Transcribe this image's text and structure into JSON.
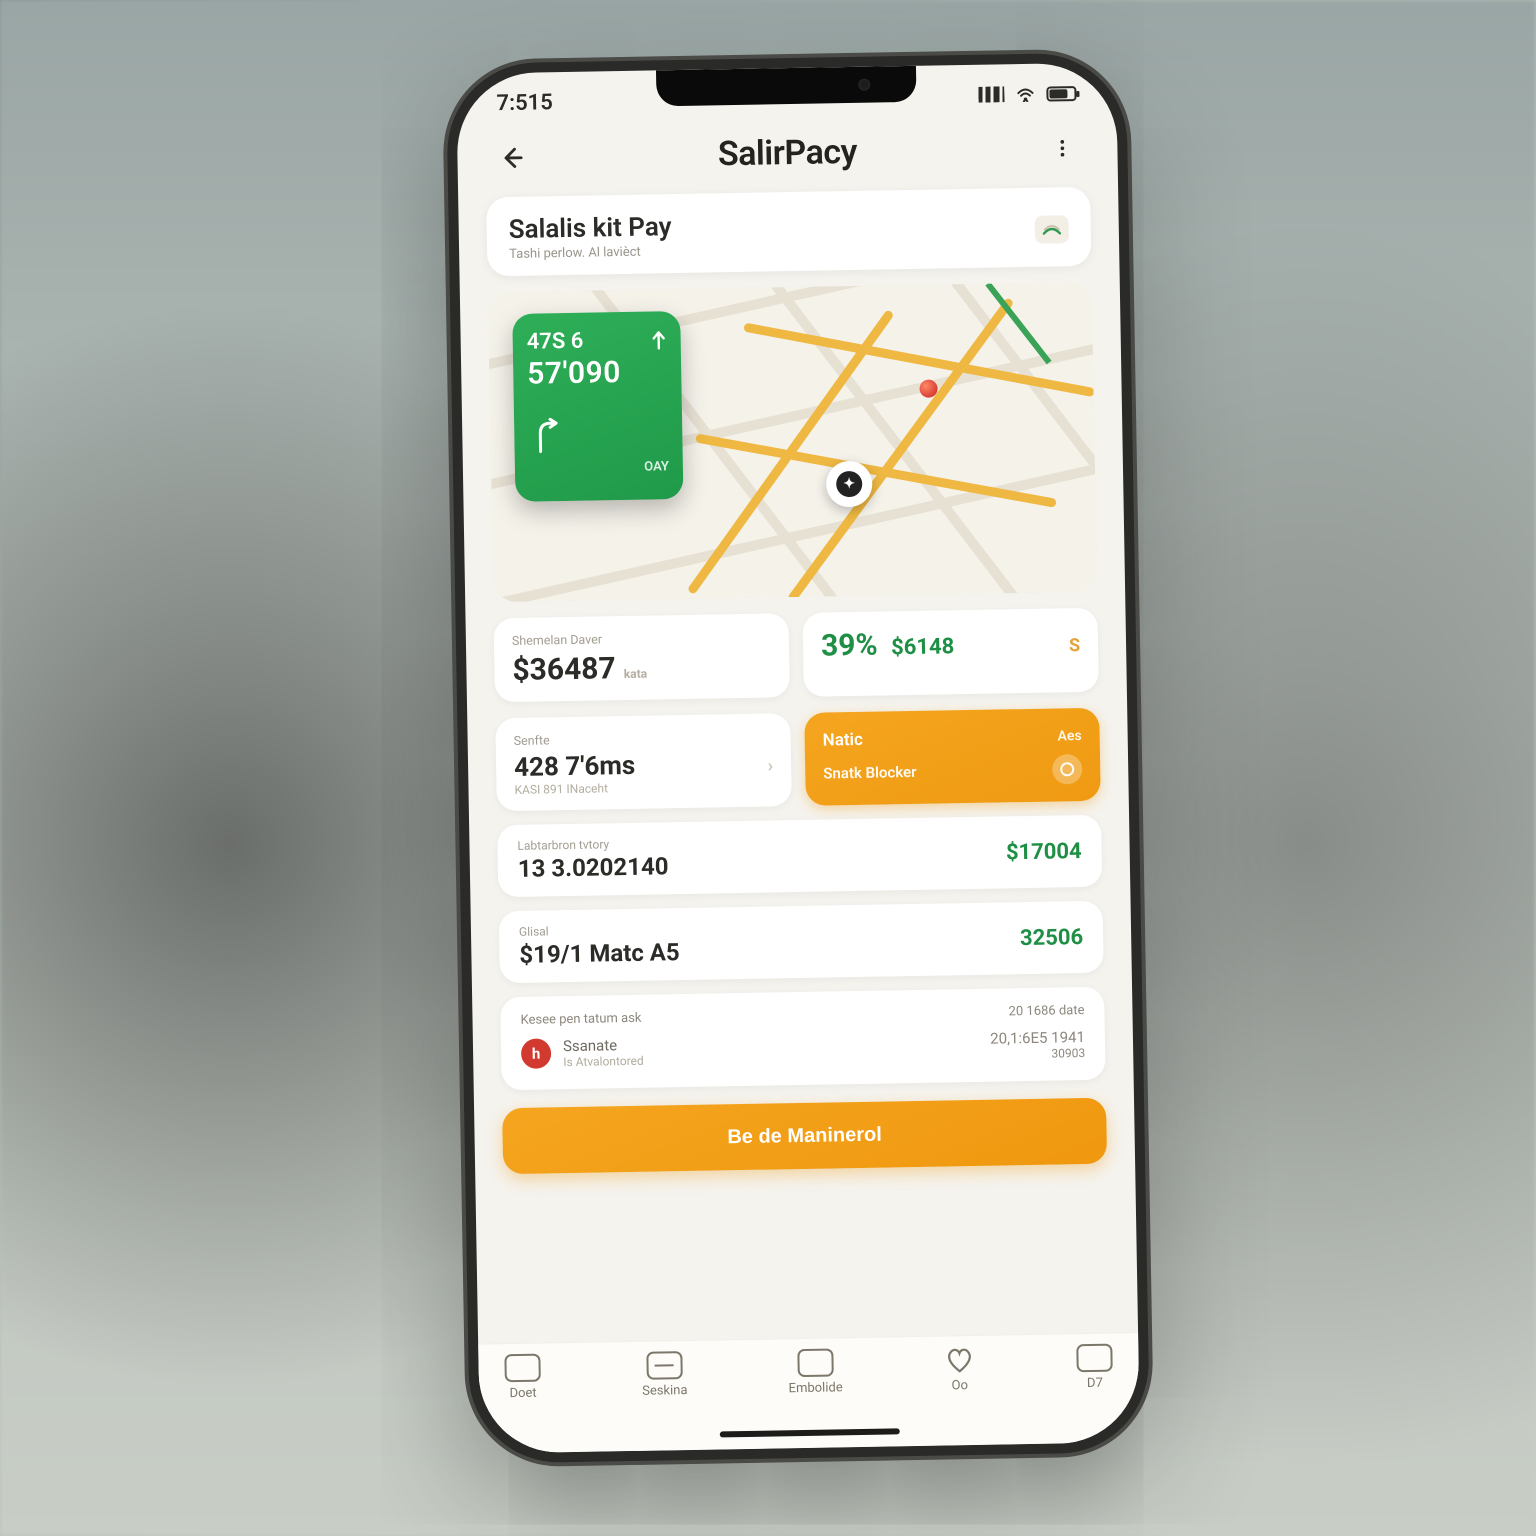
{
  "status": {
    "time": "7:515"
  },
  "appbar": {
    "title": "SalirPacy"
  },
  "search": {
    "title": "Salalis kit Pay",
    "subtitle": "Tashi perlow. Al lavièct"
  },
  "mapcard": {
    "line1": "47S 6",
    "line2": "57'090",
    "corner": "OAY"
  },
  "tiles": {
    "balance": {
      "label": "Shemelan Daver",
      "value": "$36487",
      "suffix": "kata"
    },
    "earnings": {
      "pct": "39%",
      "amt": "$6148",
      "suffix": "S"
    },
    "trips": {
      "label": "Senfte",
      "value": "428 7'6ms",
      "sub": "KASI 891 INaceht"
    },
    "action": {
      "line1_left": "Natic",
      "line1_right": "Aes",
      "line2": "Snatk Blocker"
    }
  },
  "rows": {
    "r1": {
      "label": "Labtarbron tvtory",
      "value": "13 3.0202140",
      "right": "$17004"
    },
    "r2": {
      "label": "Glisal",
      "value": "$19/1 Matc A5",
      "right": "32506"
    }
  },
  "summary": {
    "header_left": "Kesee pen tatum ask",
    "header_right": "20 1686 date",
    "line1": "Ssanate",
    "line1_amt": "20,1:6E5 1941",
    "line2": "Is Atvalontored",
    "line2_amt": "30903"
  },
  "cta": {
    "label": "Be de Maninerol"
  },
  "tabs": {
    "t1": "Doet",
    "t2": "Seskina",
    "t3": "Embolide",
    "t4": "Oo",
    "t5": "D7"
  },
  "colors": {
    "green": "#1f9a49",
    "orange": "#ef980f",
    "red": "#d33a2f"
  }
}
